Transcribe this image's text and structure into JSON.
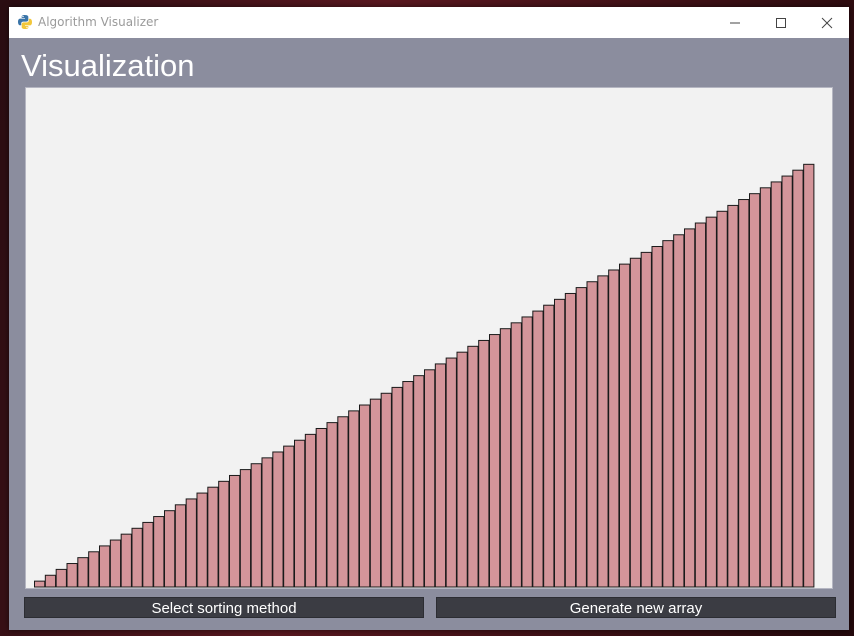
{
  "window": {
    "title": "Algorithm Visualizer",
    "icon": "python-icon"
  },
  "main": {
    "heading": "Visualization"
  },
  "controls": {
    "sort_button_label": "Select sorting method",
    "generate_button_label": "Generate new array"
  },
  "colors": {
    "bar_fill": "#d4959a",
    "bar_stroke": "#1a1a1a",
    "canvas_bg": "#f2f2f2",
    "window_bg": "#8b8d9e",
    "button_bg": "#3b3c43"
  },
  "chart_data": {
    "type": "bar",
    "title": "",
    "xlabel": "",
    "ylabel": "",
    "values": [
      1,
      2,
      3,
      4,
      5,
      6,
      7,
      8,
      9,
      10,
      11,
      12,
      13,
      14,
      15,
      16,
      17,
      18,
      19,
      20,
      21,
      22,
      23,
      24,
      25,
      26,
      27,
      28,
      29,
      30,
      31,
      32,
      33,
      34,
      35,
      36,
      37,
      38,
      39,
      40,
      41,
      42,
      43,
      44,
      45,
      46,
      47,
      48,
      49,
      50,
      51,
      52,
      53,
      54,
      55,
      56,
      57,
      58,
      59,
      60,
      61,
      62,
      63,
      64,
      65,
      66,
      67,
      68,
      69,
      70,
      71,
      72
    ],
    "ylim": [
      0,
      85
    ]
  }
}
